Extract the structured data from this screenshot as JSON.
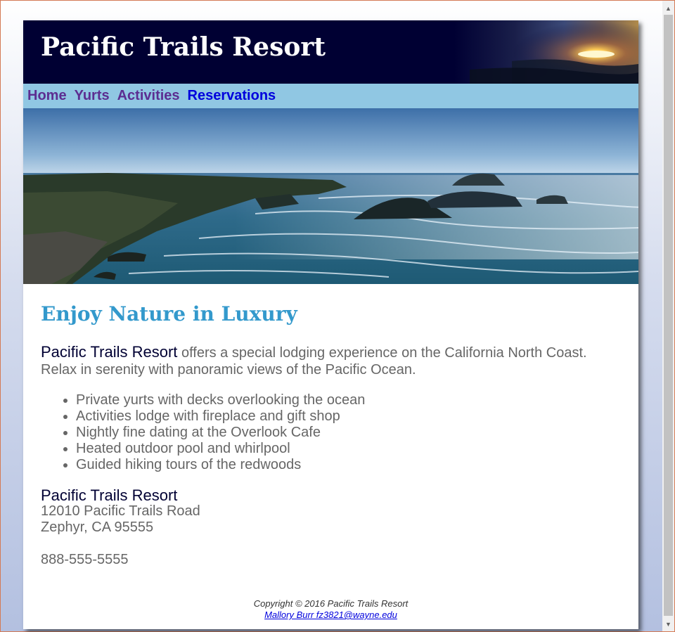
{
  "header": {
    "title": "Pacific Trails Resort"
  },
  "nav": {
    "items": [
      {
        "label": "Home"
      },
      {
        "label": "Yurts"
      },
      {
        "label": "Activities"
      },
      {
        "label": "Reservations"
      }
    ]
  },
  "main": {
    "heading": "Enjoy Nature in Luxury",
    "intro_name": "Pacific Trails Resort",
    "intro_text": " offers a special lodging experience on the California North Coast. Relax in serenity with panoramic views of the Pacific Ocean.",
    "features": [
      "Private yurts with decks overlooking the ocean",
      "Activities lodge with fireplace and gift shop",
      "Nightly fine dating at the Overlook Cafe",
      "Heated outdoor pool and whirlpool",
      "Guided hiking tours of the redwoods"
    ],
    "contact": {
      "name": "Pacific Trails Resort",
      "street": "12010 Pacific Trails Road",
      "city": "Zephyr, CA 95555",
      "phone": "888-555-5555"
    }
  },
  "footer": {
    "copyright": "Copyright © 2016 Pacific Trails Resort",
    "email_link": "Mallory Burr fz3821@wayne.edu"
  },
  "colors": {
    "header_bg": "#000033",
    "nav_bg": "#90c7e3",
    "heading": "#3399cc",
    "text": "#666666"
  }
}
